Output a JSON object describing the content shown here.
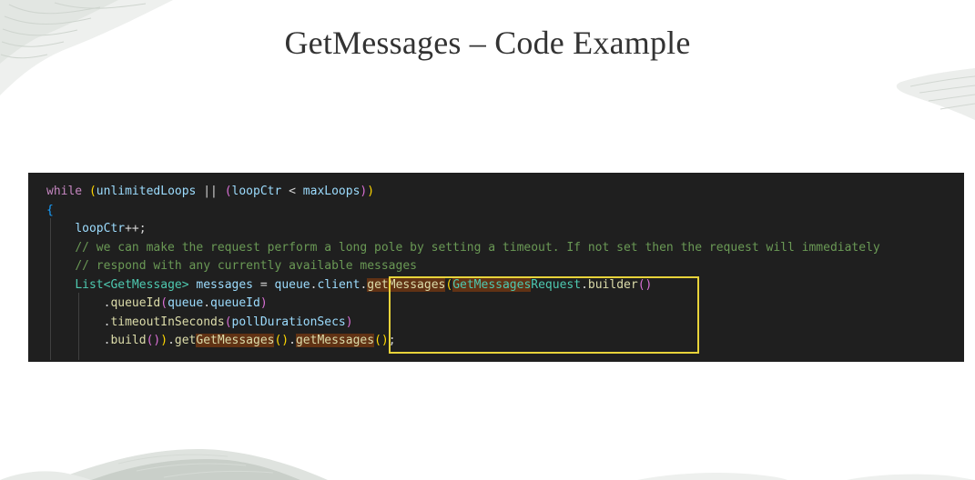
{
  "slide": {
    "title": "GetMessages – Code Example"
  },
  "code": {
    "lines": [
      {
        "tokens": [
          {
            "t": "while",
            "c": "kw"
          },
          {
            "t": " "
          },
          {
            "t": "(",
            "c": "p1"
          },
          {
            "t": "unlimitedLoops",
            "c": "var"
          },
          {
            "t": " || "
          },
          {
            "t": "(",
            "c": "p2"
          },
          {
            "t": "loopCtr",
            "c": "var"
          },
          {
            "t": " < "
          },
          {
            "t": "maxLoops",
            "c": "var"
          },
          {
            "t": ")",
            "c": "p2"
          },
          {
            "t": ")",
            "c": "p1"
          }
        ]
      },
      {
        "tokens": [
          {
            "t": "{",
            "c": "p3"
          }
        ]
      },
      {
        "tokens": [
          {
            "t": "    "
          },
          {
            "t": "loopCtr",
            "c": "var"
          },
          {
            "t": "++;"
          }
        ]
      },
      {
        "tokens": [
          {
            "t": "    "
          },
          {
            "t": "// we can make the request perform a long pole by setting a timeout. If not set then the request will immediately",
            "c": "cm"
          }
        ]
      },
      {
        "tokens": [
          {
            "t": "    "
          },
          {
            "t": "// respond with any currently available messages",
            "c": "cm"
          }
        ]
      },
      {
        "tokens": [
          {
            "t": "    "
          },
          {
            "t": "List",
            "c": "ty"
          },
          {
            "t": "<",
            "c": "ty"
          },
          {
            "t": "GetMessage",
            "c": "ty"
          },
          {
            "t": ">",
            "c": "ty"
          },
          {
            "t": " "
          },
          {
            "t": "messages",
            "c": "var"
          },
          {
            "t": " = "
          },
          {
            "t": "queue",
            "c": "var"
          },
          {
            "t": "."
          },
          {
            "t": "client",
            "c": "var"
          },
          {
            "t": "."
          },
          {
            "t": "getMessages",
            "c": "fn",
            "hl": true
          },
          {
            "t": "(",
            "c": "p1"
          },
          {
            "t": "GetMessages",
            "c": "ty",
            "hl": true
          },
          {
            "t": "Request",
            "c": "ty"
          },
          {
            "t": "."
          },
          {
            "t": "builder",
            "c": "fn"
          },
          {
            "t": "()",
            "c": "p2"
          }
        ]
      },
      {
        "tokens": [
          {
            "t": "        ."
          },
          {
            "t": "queueId",
            "c": "fn"
          },
          {
            "t": "(",
            "c": "p2"
          },
          {
            "t": "queue",
            "c": "var"
          },
          {
            "t": "."
          },
          {
            "t": "queueId",
            "c": "var"
          },
          {
            "t": ")",
            "c": "p2"
          }
        ]
      },
      {
        "tokens": [
          {
            "t": "        ."
          },
          {
            "t": "timeoutInSeconds",
            "c": "fn"
          },
          {
            "t": "(",
            "c": "p2"
          },
          {
            "t": "pollDurationSecs",
            "c": "var"
          },
          {
            "t": ")",
            "c": "p2"
          }
        ]
      },
      {
        "tokens": [
          {
            "t": "        ."
          },
          {
            "t": "build",
            "c": "fn"
          },
          {
            "t": "()",
            "c": "p2"
          },
          {
            "t": ")",
            "c": "p1"
          },
          {
            "t": "."
          },
          {
            "t": "get",
            "c": "fn"
          },
          {
            "t": "GetMessages",
            "c": "fn",
            "hl": true
          },
          {
            "t": "()",
            "c": "p1"
          },
          {
            "t": "."
          },
          {
            "t": "getMessages",
            "c": "fn",
            "hl": true
          },
          {
            "t": "()",
            "c": "p1"
          },
          {
            "t": ";"
          }
        ]
      }
    ]
  }
}
